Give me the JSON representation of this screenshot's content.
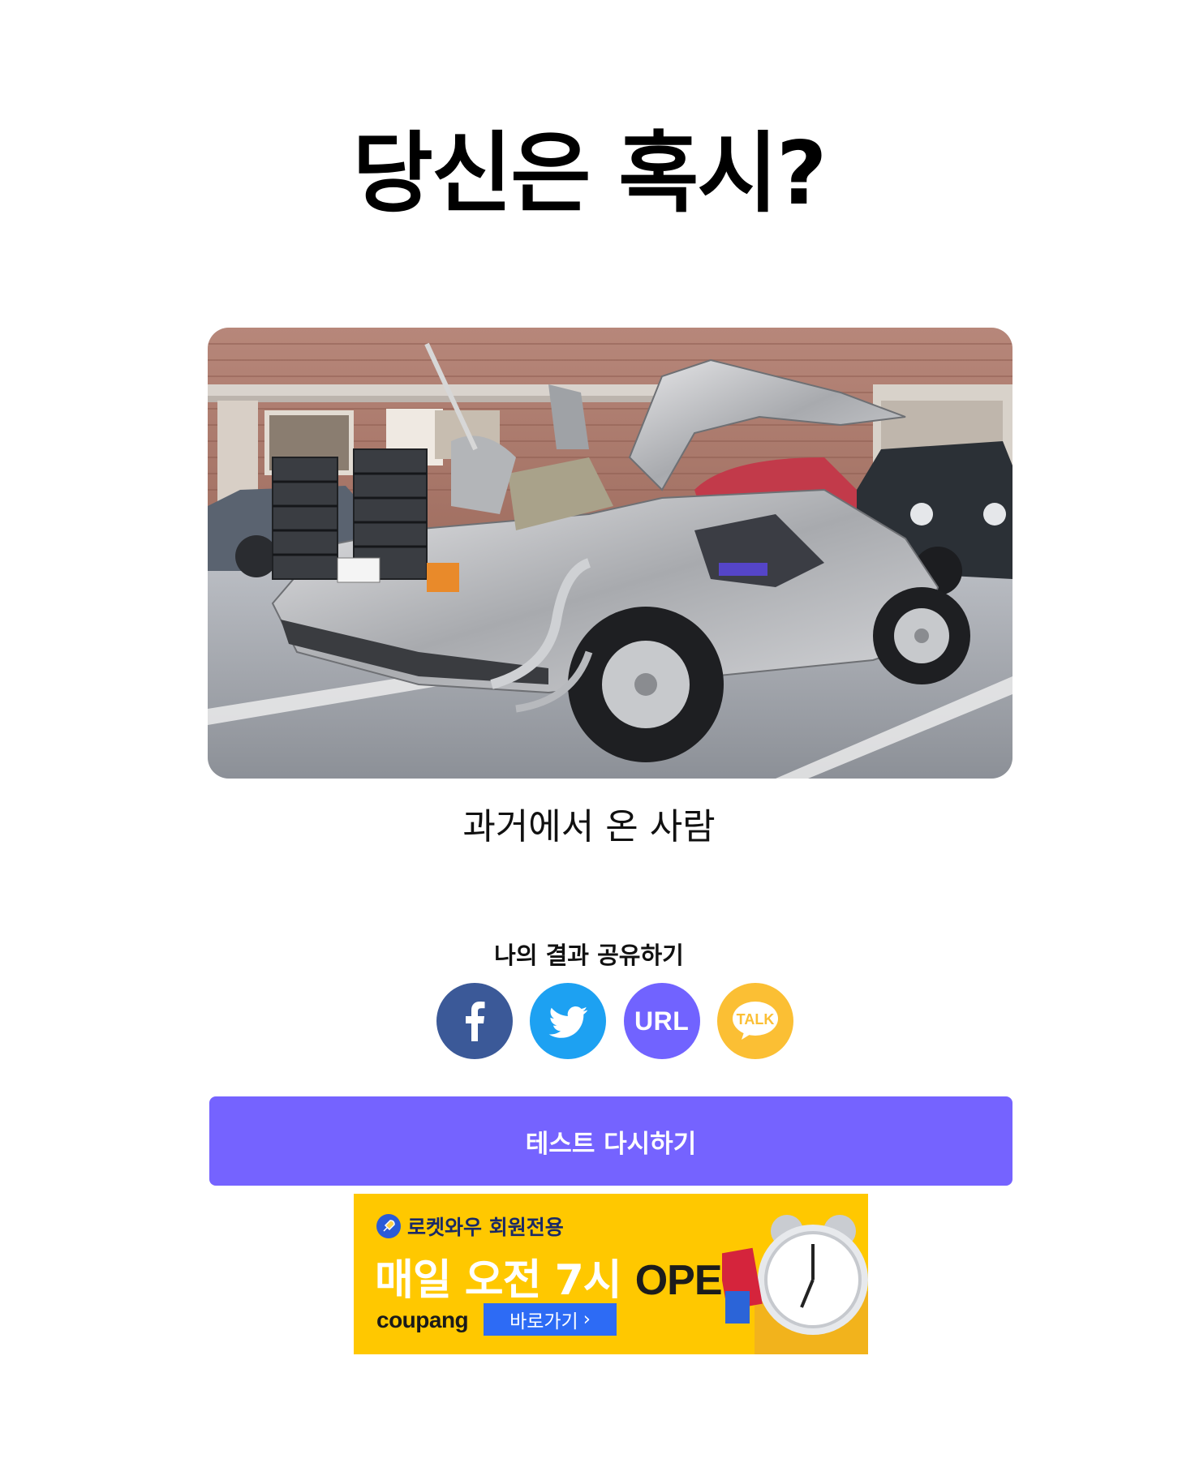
{
  "page": {
    "title": "당신은 혹시?"
  },
  "result": {
    "image_alt": "DeLorean time machine car",
    "text": "과거에서 온 사람"
  },
  "share": {
    "title": "나의 결과 공유하기",
    "buttons": [
      {
        "id": "facebook",
        "icon": "facebook-icon",
        "color": "#3b5998"
      },
      {
        "id": "twitter",
        "icon": "twitter-icon",
        "color": "#1da1f2"
      },
      {
        "id": "url",
        "label": "URL",
        "color": "#7163ff"
      },
      {
        "id": "kakaotalk",
        "label": "TALK",
        "color": "#fbbf34"
      }
    ]
  },
  "retry": {
    "label": "테스트 다시하기",
    "color": "#7563ff"
  },
  "ad": {
    "top_label": "로켓와우 회원전용",
    "headline_white": "매일 오전 7시 ",
    "headline_dark": "OPEN",
    "brand": "coupang",
    "cta": "바로가기",
    "background": "#ffc800"
  }
}
